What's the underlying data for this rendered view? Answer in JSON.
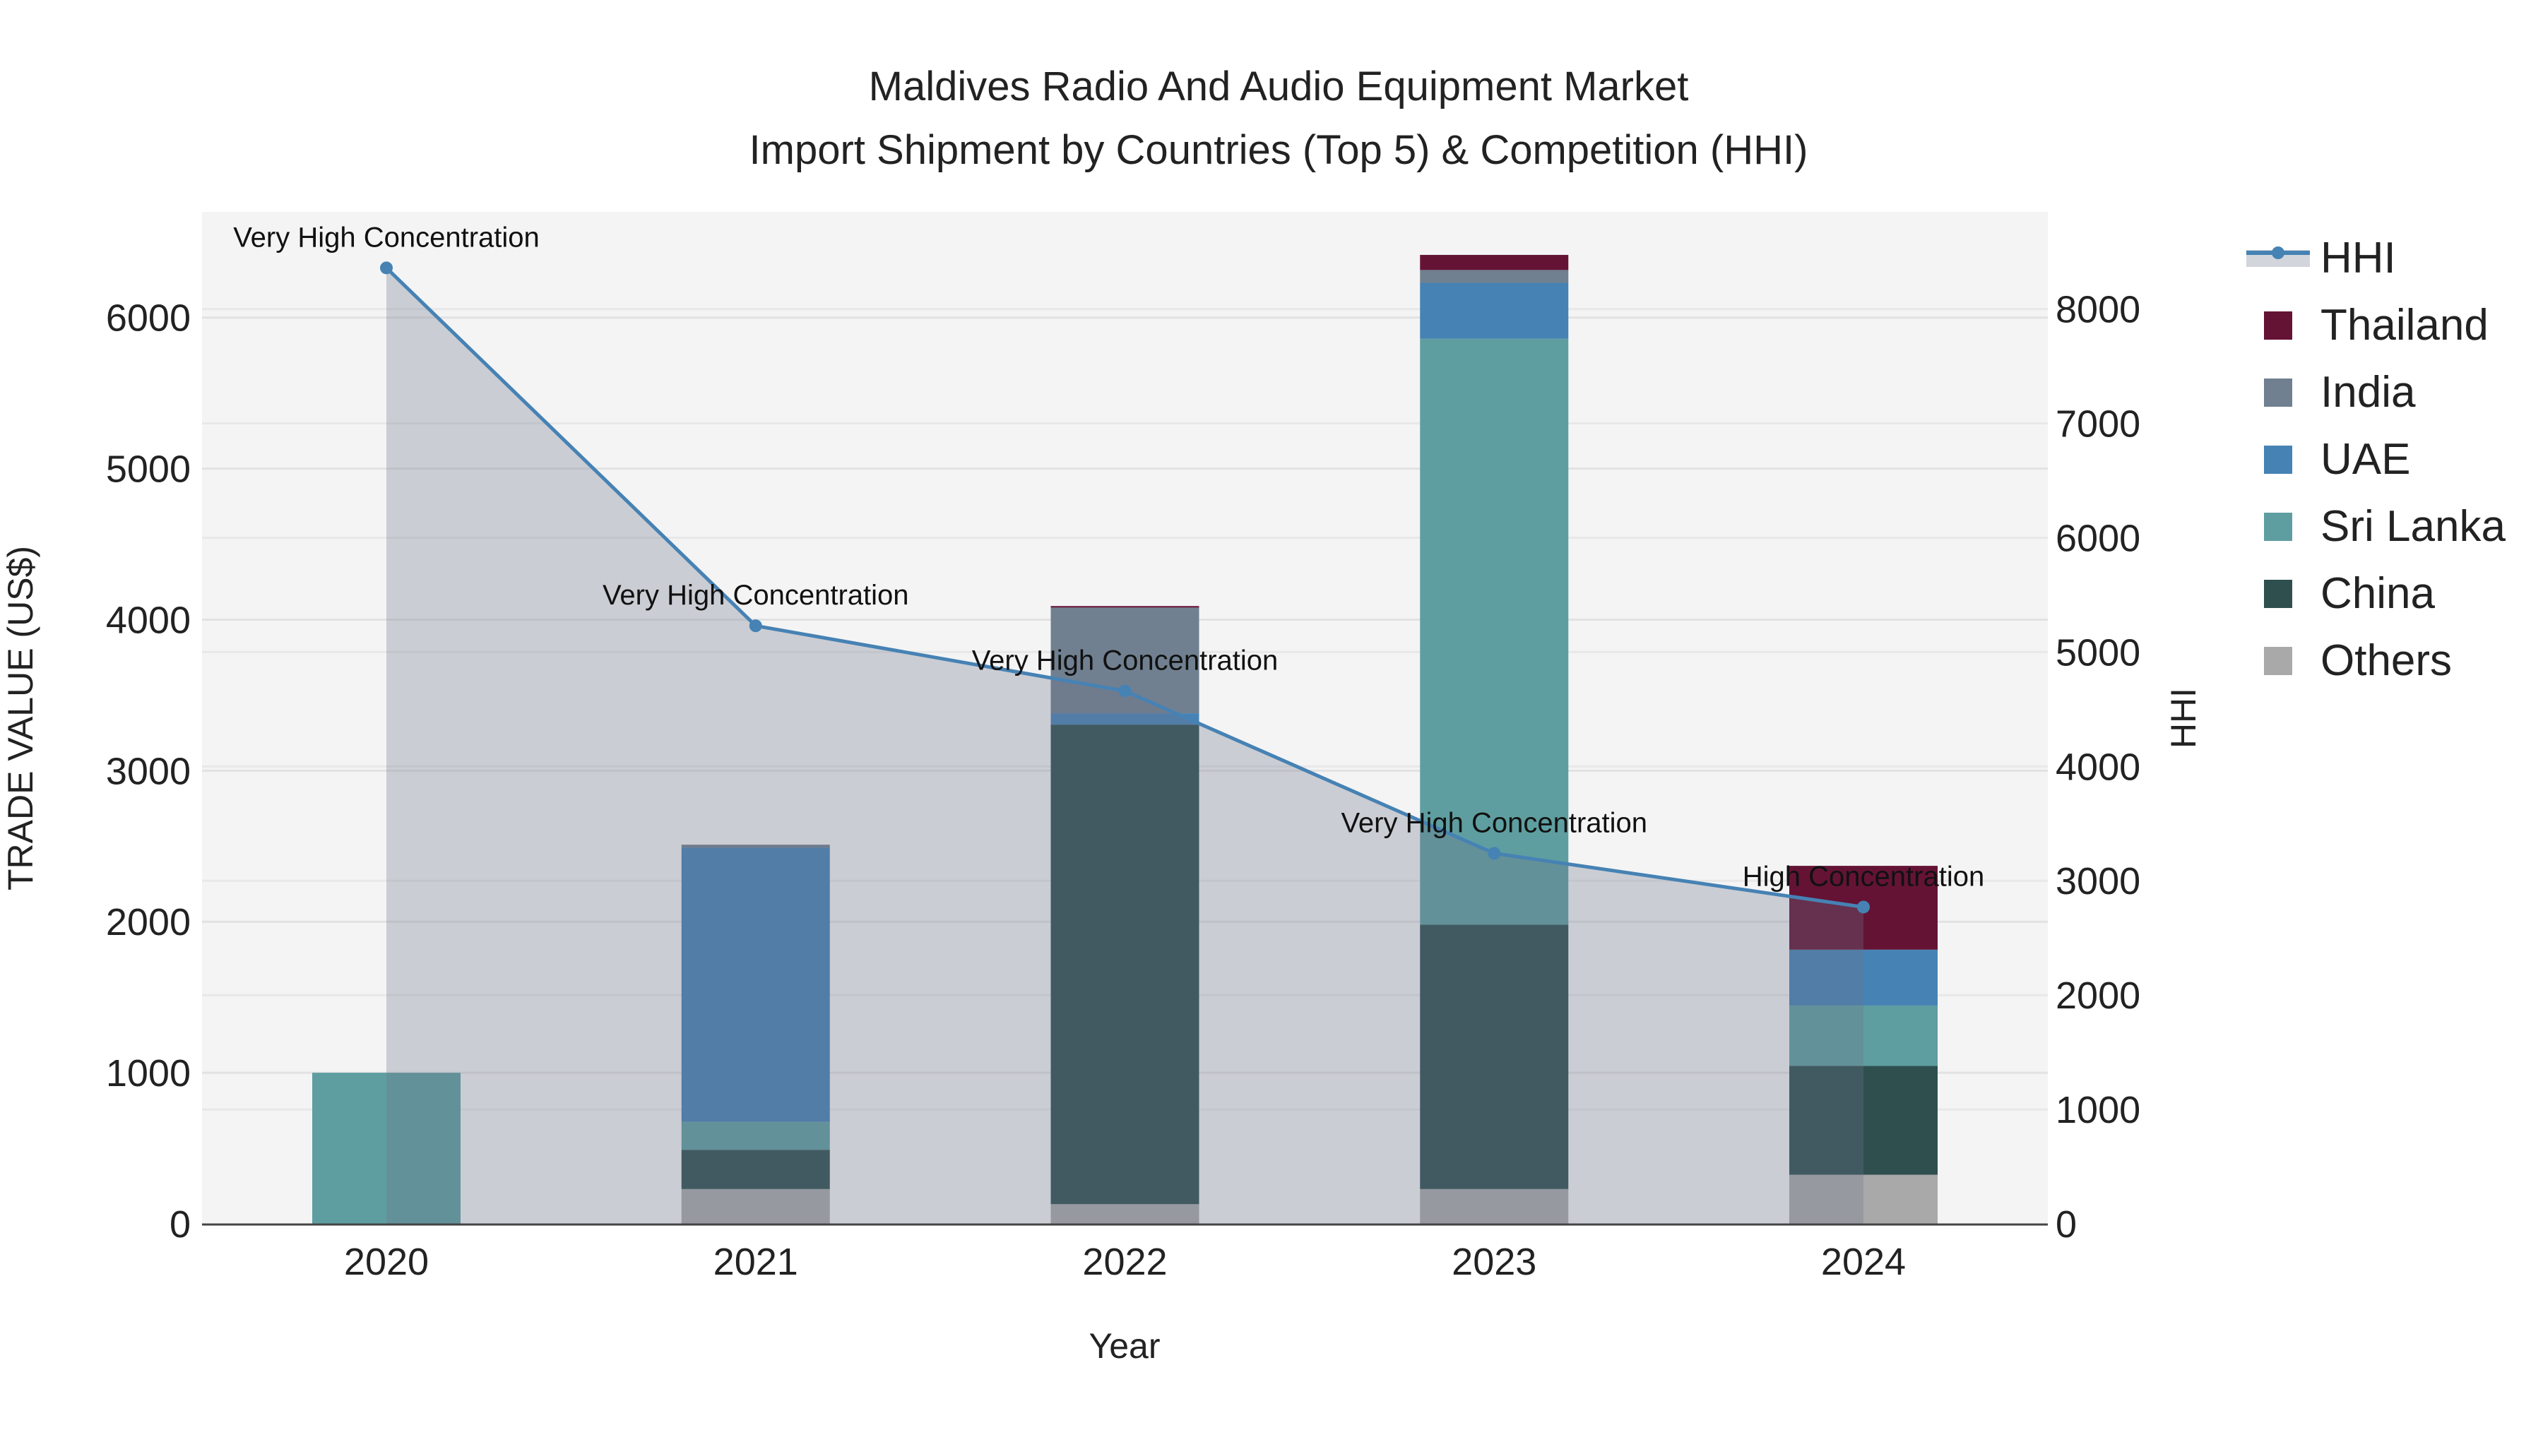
{
  "chart_data": {
    "type": "bar",
    "title": "Maldives Radio And Audio Equipment Market",
    "subtitle": "Import Shipment by Countries (Top 5) & Competition (HHI)",
    "xlabel": "Year",
    "ylabel": "TRADE VALUE (US$)",
    "y2label": "HHI",
    "categories": [
      "2020",
      "2021",
      "2022",
      "2023",
      "2024"
    ],
    "ylim": [
      0,
      6700
    ],
    "y2lim": [
      0,
      8850
    ],
    "yticks": [
      0,
      1000,
      2000,
      3000,
      4000,
      5000,
      6000
    ],
    "y2ticks": [
      0,
      1000,
      2000,
      3000,
      4000,
      5000,
      6000,
      7000,
      8000
    ],
    "stacked": true,
    "series": [
      {
        "name": "Others",
        "color": "#a9a9a9",
        "values": [
          0,
          230,
          130,
          230,
          325
        ]
      },
      {
        "name": "China",
        "color": "#2f4f4f",
        "values": [
          0,
          260,
          3175,
          1750,
          720
        ]
      },
      {
        "name": "Sri Lanka",
        "color": "#5f9ea0",
        "values": [
          1000,
          185,
          0,
          3880,
          400
        ]
      },
      {
        "name": "UAE",
        "color": "#4682b4",
        "values": [
          0,
          1815,
          75,
          370,
          370
        ]
      },
      {
        "name": "India",
        "color": "#708090",
        "values": [
          0,
          20,
          700,
          85,
          0
        ]
      },
      {
        "name": "Thailand",
        "color": "#641335",
        "values": [
          0,
          0,
          10,
          100,
          555
        ]
      }
    ],
    "line": {
      "name": "HHI",
      "color": "#4682b4",
      "axis": "right",
      "values": [
        8360,
        5230,
        4660,
        3240,
        2770
      ]
    },
    "annotations": [
      "Very High Concentration",
      "Very High Concentration",
      "Very High Concentration",
      "Very High Concentration",
      "High Concentration"
    ],
    "legend": {
      "placement": "right",
      "entries": [
        "HHI",
        "Thailand",
        "India",
        "UAE",
        "Sri Lanka",
        "China",
        "Others"
      ]
    },
    "grid": true
  }
}
